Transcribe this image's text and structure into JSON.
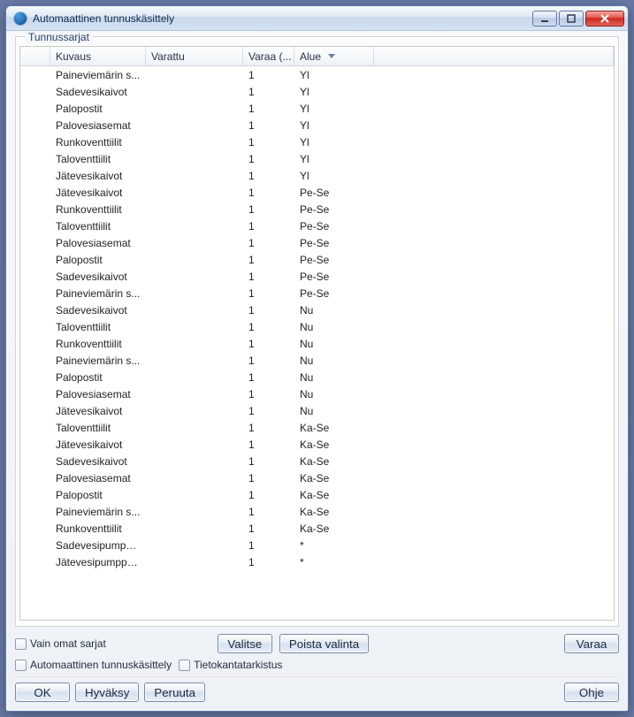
{
  "titlebar": {
    "title": "Automaattinen tunnuskäsittely"
  },
  "group": {
    "title": "Tunnussarjat"
  },
  "columns": {
    "c1": "Kuvaus",
    "c2": "Varattu",
    "c3": "Varaa (...",
    "c4": "Alue"
  },
  "rows": [
    {
      "kuvaus": "Paineviemärin s...",
      "varattu": "",
      "varaa": "1",
      "alue": "Yl"
    },
    {
      "kuvaus": "Sadevesikaivot",
      "varattu": "",
      "varaa": "1",
      "alue": "Yl"
    },
    {
      "kuvaus": "Palopostit",
      "varattu": "",
      "varaa": "1",
      "alue": "Yl"
    },
    {
      "kuvaus": "Palovesiasemat",
      "varattu": "",
      "varaa": "1",
      "alue": "Yl"
    },
    {
      "kuvaus": "Runkoventtiilit",
      "varattu": "",
      "varaa": "1",
      "alue": "Yl"
    },
    {
      "kuvaus": "Taloventtiilit",
      "varattu": "",
      "varaa": "1",
      "alue": "Yl"
    },
    {
      "kuvaus": "Jätevesikaivot",
      "varattu": "",
      "varaa": "1",
      "alue": "Yl"
    },
    {
      "kuvaus": "Jätevesikaivot",
      "varattu": "",
      "varaa": "1",
      "alue": "Pe-Se"
    },
    {
      "kuvaus": "Runkoventtiilit",
      "varattu": "",
      "varaa": "1",
      "alue": "Pe-Se"
    },
    {
      "kuvaus": "Taloventtiilit",
      "varattu": "",
      "varaa": "1",
      "alue": "Pe-Se"
    },
    {
      "kuvaus": "Palovesiasemat",
      "varattu": "",
      "varaa": "1",
      "alue": "Pe-Se"
    },
    {
      "kuvaus": "Palopostit",
      "varattu": "",
      "varaa": "1",
      "alue": "Pe-Se"
    },
    {
      "kuvaus": "Sadevesikaivot",
      "varattu": "",
      "varaa": "1",
      "alue": "Pe-Se"
    },
    {
      "kuvaus": "Paineviemärin s...",
      "varattu": "",
      "varaa": "1",
      "alue": "Pe-Se"
    },
    {
      "kuvaus": "Sadevesikaivot",
      "varattu": "",
      "varaa": "1",
      "alue": "Nu"
    },
    {
      "kuvaus": "Taloventtiilit",
      "varattu": "",
      "varaa": "1",
      "alue": "Nu"
    },
    {
      "kuvaus": "Runkoventtiilit",
      "varattu": "",
      "varaa": "1",
      "alue": "Nu"
    },
    {
      "kuvaus": "Paineviemärin s...",
      "varattu": "",
      "varaa": "1",
      "alue": "Nu"
    },
    {
      "kuvaus": "Palopostit",
      "varattu": "",
      "varaa": "1",
      "alue": "Nu"
    },
    {
      "kuvaus": "Palovesiasemat",
      "varattu": "",
      "varaa": "1",
      "alue": "Nu"
    },
    {
      "kuvaus": "Jätevesikaivot",
      "varattu": "",
      "varaa": "1",
      "alue": "Nu"
    },
    {
      "kuvaus": "Taloventtiilit",
      "varattu": "",
      "varaa": "1",
      "alue": "Ka-Se"
    },
    {
      "kuvaus": "Jätevesikaivot",
      "varattu": "",
      "varaa": "1",
      "alue": "Ka-Se"
    },
    {
      "kuvaus": "Sadevesikaivot",
      "varattu": "",
      "varaa": "1",
      "alue": "Ka-Se"
    },
    {
      "kuvaus": "Palovesiasemat",
      "varattu": "",
      "varaa": "1",
      "alue": "Ka-Se"
    },
    {
      "kuvaus": "Palopostit",
      "varattu": "",
      "varaa": "1",
      "alue": "Ka-Se"
    },
    {
      "kuvaus": "Paineviemärin s...",
      "varattu": "",
      "varaa": "1",
      "alue": "Ka-Se"
    },
    {
      "kuvaus": "Runkoventtiilit",
      "varattu": "",
      "varaa": "1",
      "alue": "Ka-Se"
    },
    {
      "kuvaus": "Sadevesipumpp...",
      "varattu": "",
      "varaa": "1",
      "alue": "*"
    },
    {
      "kuvaus": "Jätevesipumppa...",
      "varattu": "",
      "varaa": "1",
      "alue": "*"
    }
  ],
  "toolbar": {
    "own_only": "Vain omat sarjat",
    "select": "Valitse",
    "deselect": "Poista valinta",
    "reserve": "Varaa"
  },
  "options": {
    "auto": "Automaattinen tunnuskäsittely",
    "dbcheck": "Tietokantatarkistus"
  },
  "footer": {
    "ok": "OK",
    "apply": "Hyväksy",
    "cancel": "Peruuta",
    "help": "Ohje"
  }
}
